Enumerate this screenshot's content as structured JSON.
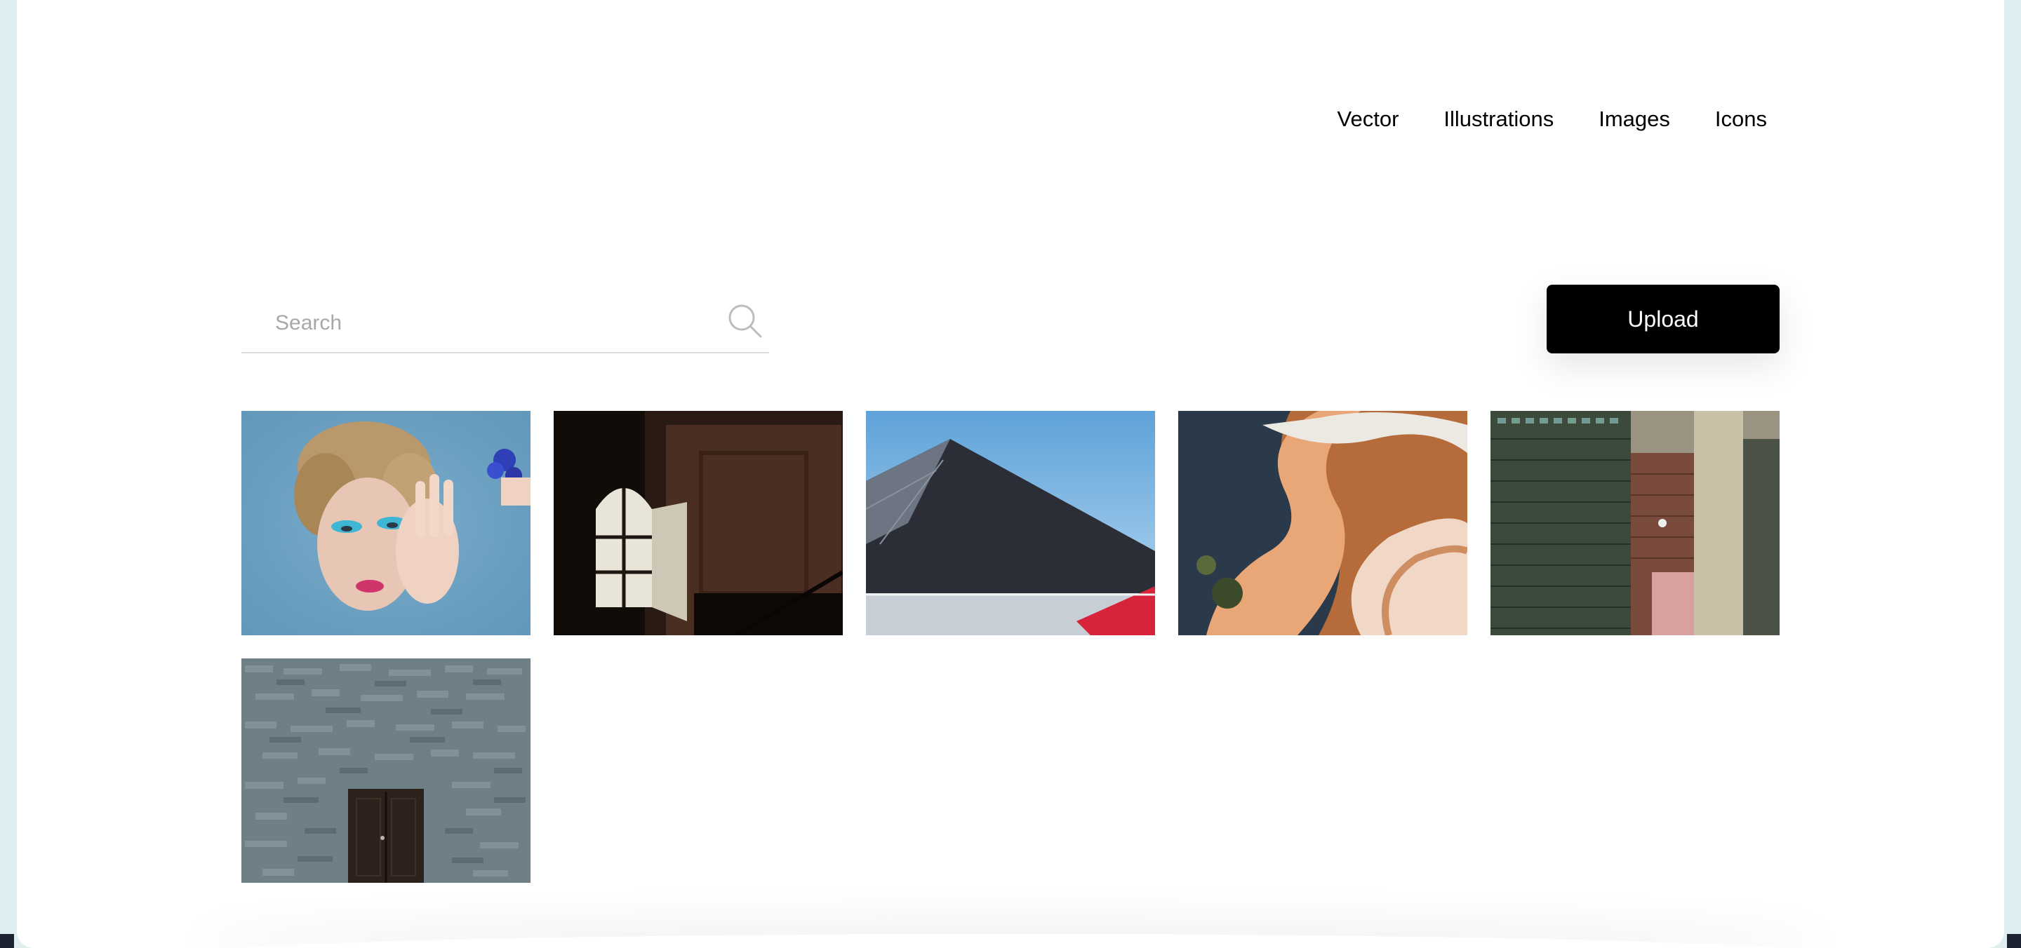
{
  "nav": {
    "items": [
      {
        "label": "Vector"
      },
      {
        "label": "Illustrations"
      },
      {
        "label": "Images"
      },
      {
        "label": "Icons"
      }
    ]
  },
  "search": {
    "placeholder": "Search",
    "icon": "search-icon"
  },
  "upload": {
    "label": "Upload"
  },
  "colors": {
    "background": "#ffffff",
    "frame": "#dfeef0",
    "button": "#000000",
    "button_text": "#ffffff"
  },
  "gallery": {
    "images": [
      {
        "subject": "portrait-blue-makeup"
      },
      {
        "subject": "dark-room-window"
      },
      {
        "subject": "building-roof-sky"
      },
      {
        "subject": "aerial-abstract-landscape"
      },
      {
        "subject": "city-skyscrapers"
      },
      {
        "subject": "stone-wall-door"
      }
    ]
  }
}
